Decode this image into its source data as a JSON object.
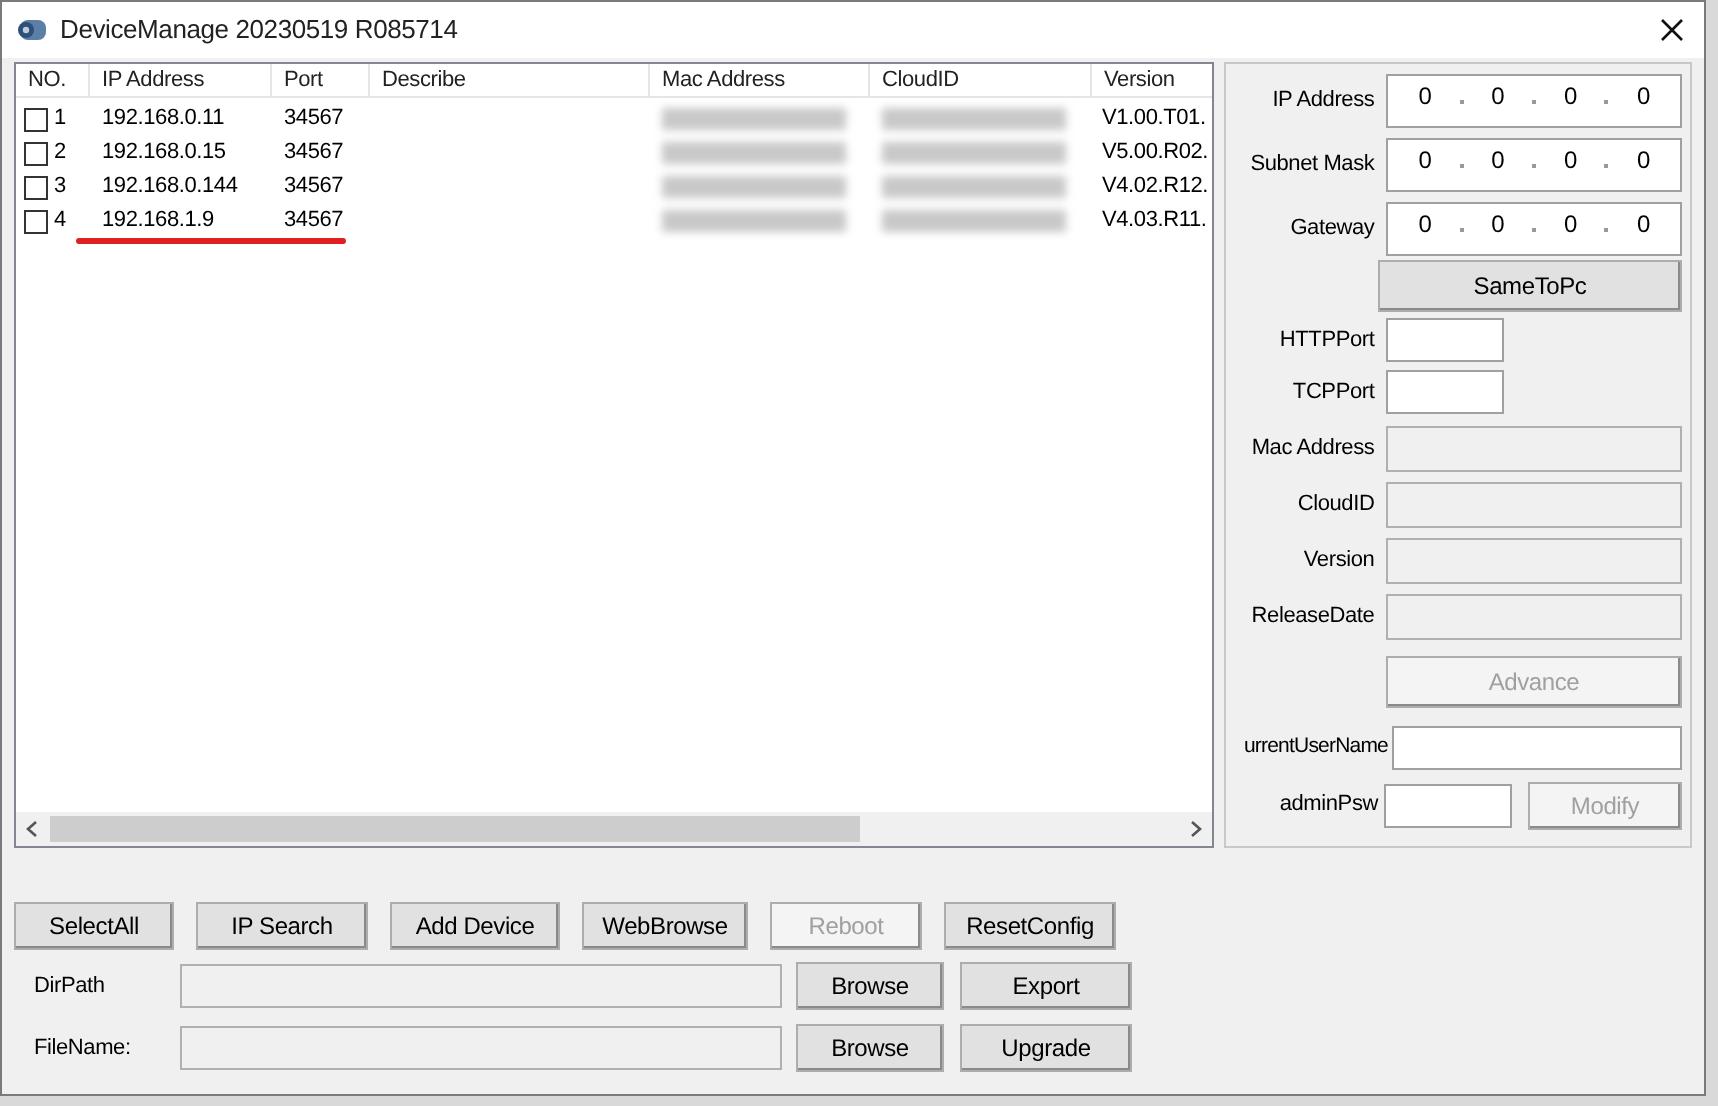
{
  "window": {
    "title": "DeviceManage 20230519 R085714"
  },
  "device_list": {
    "columns": [
      "NO.",
      "IP Address",
      "Port",
      "Describe",
      "Mac Address",
      "CloudID",
      "Version"
    ],
    "rows": [
      {
        "checked": false,
        "no": "1",
        "ip": "192.168.0.11",
        "port": "34567",
        "version": "V1.00.T01."
      },
      {
        "checked": false,
        "no": "2",
        "ip": "192.168.0.15",
        "port": "34567",
        "version": "V5.00.R02."
      },
      {
        "checked": false,
        "no": "3",
        "ip": "192.168.0.144",
        "port": "34567",
        "version": "V4.02.R12."
      },
      {
        "checked": false,
        "no": "4",
        "ip": "192.168.1.9",
        "port": "34567",
        "version": "V4.03.R11."
      }
    ]
  },
  "settings": {
    "ip_fields": [
      {
        "label": "IP Address",
        "octets": [
          "0",
          "0",
          "0",
          "0"
        ]
      },
      {
        "label": "Subnet Mask",
        "octets": [
          "0",
          "0",
          "0",
          "0"
        ]
      },
      {
        "label": "Gateway",
        "octets": [
          "0",
          "0",
          "0",
          "0"
        ]
      }
    ],
    "same_to_pc": {
      "label": "SameToPc",
      "disabled": false
    },
    "port_fields": [
      {
        "label": "HTTPPort"
      },
      {
        "label": "TCPPort"
      }
    ],
    "info_fields": [
      {
        "label": "Mac Address"
      },
      {
        "label": "CloudID"
      },
      {
        "label": "Version"
      },
      {
        "label": "ReleaseDate"
      }
    ],
    "advance": {
      "label": "Advance",
      "disabled": true
    },
    "user_name": {
      "label": "urrentUserName"
    },
    "admin_psw": {
      "label": "adminPsw"
    },
    "modify": {
      "label": "Modify",
      "disabled": true
    }
  },
  "actions": [
    {
      "label": "SelectAll",
      "disabled": false
    },
    {
      "label": "IP Search",
      "disabled": false
    },
    {
      "label": "Add Device",
      "disabled": false
    },
    {
      "label": "WebBrowse",
      "disabled": false
    },
    {
      "label": "Reboot",
      "disabled": true
    },
    {
      "label": "ResetConfig",
      "disabled": false
    }
  ],
  "file_rows": [
    {
      "label": "DirPath",
      "browse": {
        "label": "Browse",
        "disabled": false
      },
      "action": {
        "label": "Export",
        "disabled": false
      }
    },
    {
      "label": "FileName:",
      "browse": {
        "label": "Browse",
        "disabled": false
      },
      "action": {
        "label": "Upgrade",
        "disabled": false
      }
    }
  ]
}
